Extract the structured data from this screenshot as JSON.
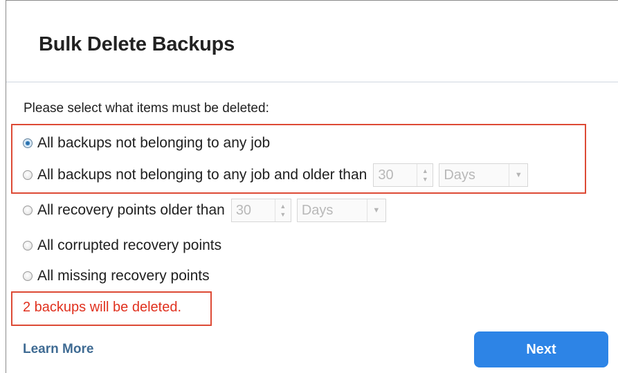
{
  "dialog": {
    "title": "Bulk Delete Backups",
    "prompt": "Please select what items must be deleted:"
  },
  "options": [
    {
      "label": "All backups not belonging to any job",
      "selected": true
    },
    {
      "label": "All backups not belonging to any job and older than",
      "selected": false,
      "amount": "30",
      "unit": "Days"
    },
    {
      "label": "All recovery points older than",
      "selected": false,
      "amount": "30",
      "unit": "Days"
    },
    {
      "label": "All corrupted recovery points",
      "selected": false
    },
    {
      "label": "All missing recovery points",
      "selected": false
    }
  ],
  "status_text": "2 backups will be deleted.",
  "footer": {
    "learn_more": "Learn More",
    "next": "Next"
  },
  "colors": {
    "highlight_box": "#dd4a35",
    "status_text": "#e0301e",
    "primary_button": "#2d84e6",
    "link": "#3f6b93"
  }
}
